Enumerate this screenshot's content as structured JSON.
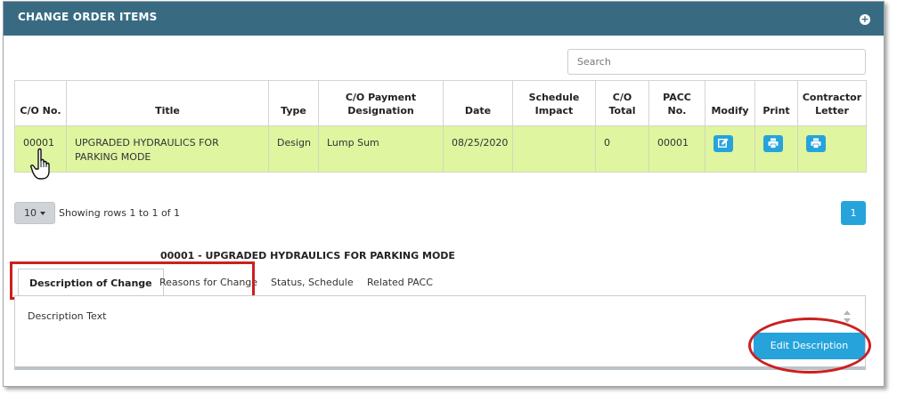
{
  "panel": {
    "title": "CHANGE ORDER ITEMS",
    "expand_icon": "plus-circle-icon"
  },
  "search": {
    "placeholder": "Search"
  },
  "table": {
    "headers": {
      "co_no": "C/O No.",
      "title": "Title",
      "type": "Type",
      "payment": "C/O Payment Designation",
      "date": "Date",
      "schedule": "Schedule Impact",
      "total": "C/O Total",
      "pacc": "PACC No.",
      "modify": "Modify",
      "print": "Print",
      "contractor_letter": "Contractor Letter"
    },
    "rows": [
      {
        "co_no": "00001",
        "title": "UPGRADED HYDRAULICS FOR PARKING MODE",
        "type": "Design",
        "payment": "Lump Sum",
        "date": "08/25/2020",
        "schedule": "",
        "total": "0",
        "pacc": "00001",
        "modify_icon": "edit-icon",
        "print_icon": "print-icon",
        "letter_icon": "print-icon"
      }
    ]
  },
  "pagination": {
    "page_size": "10",
    "summary": "Showing rows 1 to 1 of 1",
    "current_page": "1"
  },
  "detail": {
    "title": "00001 - UPGRADED HYDRAULICS FOR PARKING MODE",
    "tabs": [
      "Description of Change",
      "Reasons for Change",
      "Status, Schedule",
      "Related PACC"
    ],
    "active_tab": "Description of Change",
    "description_text": "Description Text",
    "edit_button": "Edit Description"
  },
  "colors": {
    "header": "#386b82",
    "accent": "#27a3dc",
    "selected_row": "#dff5a0",
    "annotation": "#cc1f1f"
  }
}
